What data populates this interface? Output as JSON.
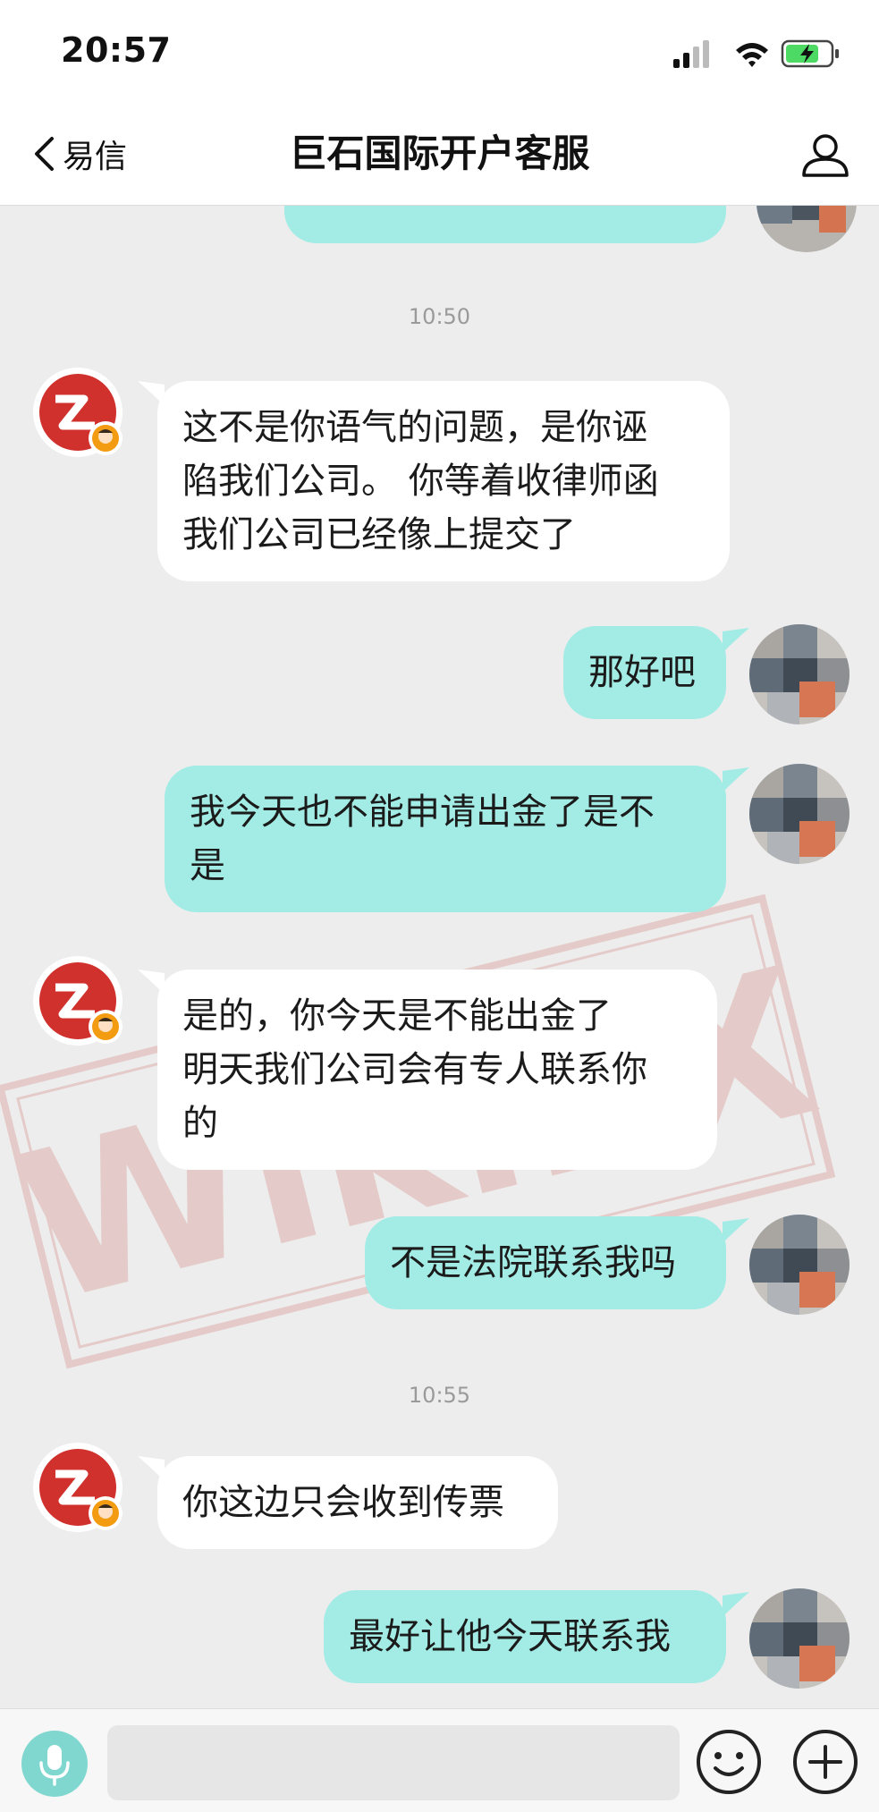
{
  "status_bar": {
    "time": "20:57"
  },
  "nav": {
    "back_label": "易信",
    "title": "巨石国际开户客服"
  },
  "colors": {
    "incoming_bubble": "#ffffff",
    "outgoing_bubble": "#a3ece6",
    "background": "#ededed",
    "voice_button": "#7fd7d0",
    "watermark": "#c0392b"
  },
  "watermark_text": "WikiFX",
  "chat": {
    "timestamps": [
      "10:50",
      "10:55"
    ],
    "messages": [
      {
        "side": "left",
        "lines": [
          "这不是你语气的问题，是你诬",
          "陷我们公司。 你等着收律师函",
          "我们公司已经像上提交了"
        ]
      },
      {
        "side": "right",
        "lines": [
          "那好吧"
        ]
      },
      {
        "side": "right",
        "lines": [
          "我今天也不能申请出金了是不",
          "是"
        ]
      },
      {
        "side": "left",
        "lines": [
          "是的，你今天是不能出金了",
          "明天我们公司会有专人联系你",
          "的"
        ]
      },
      {
        "side": "right",
        "lines": [
          "不是法院联系我吗"
        ]
      },
      {
        "side": "left",
        "lines": [
          "你这边只会收到传票"
        ]
      },
      {
        "side": "right",
        "lines": [
          "最好让他今天联系我"
        ]
      }
    ]
  },
  "icons": {
    "back": "chevron-left-icon",
    "profile": "person-icon",
    "voice": "microphone-icon",
    "emoji": "smiley-icon",
    "more": "plus-icon"
  },
  "input": {
    "value": "",
    "placeholder": ""
  }
}
